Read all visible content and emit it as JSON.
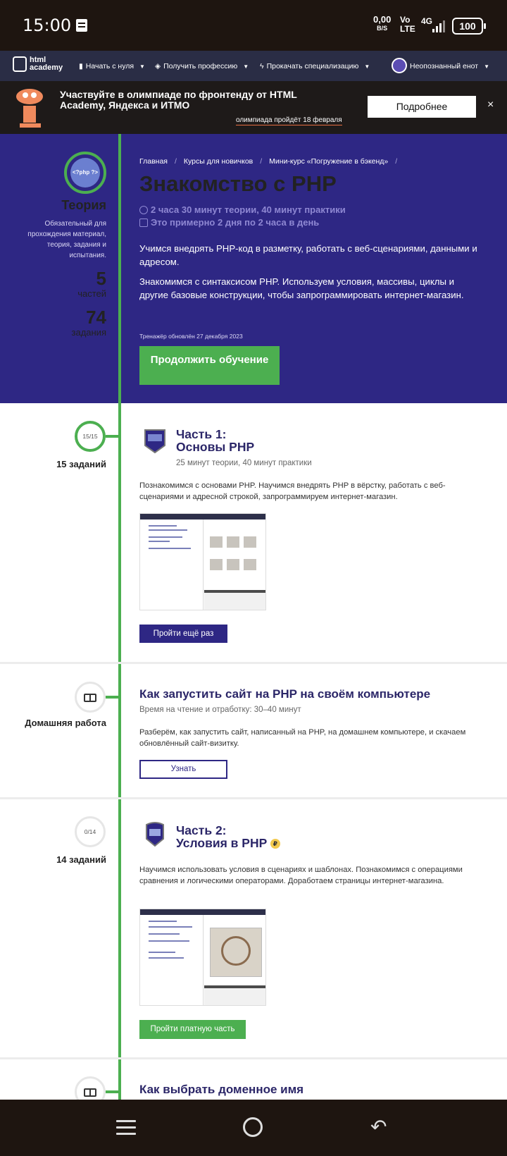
{
  "statusbar": {
    "time": "15:00",
    "speed": "0,00",
    "speed_unit": "B/S",
    "volte": "Vo",
    "lte": "LTE",
    "net": "4G",
    "battery": "100"
  },
  "nav": {
    "logo_line1": "html",
    "logo_line2": "academy",
    "items": [
      {
        "label": "Начать с нуля",
        "icon": "bars-icon"
      },
      {
        "label": "Получить профессию",
        "icon": "cap-icon"
      },
      {
        "label": "Прокачать специализацию",
        "icon": "bolt-icon"
      }
    ],
    "user": "Неопознанный енот"
  },
  "banner": {
    "title": "Участвуйте в олимпиаде по фронтенду от HTML Academy, Яндекса и ИТМО",
    "date": "олимпиада пройдёт 18 февраля",
    "button": "Подробнее",
    "close": "×"
  },
  "hero": {
    "badge": "<?php ?>",
    "side_title": "Теория",
    "side_desc": "Обязательный для прохождения материал, теория, задания и испытания.",
    "parts_count": "5",
    "parts_label": "частей",
    "tasks_count": "74",
    "tasks_label": "задания",
    "breadcrumbs": [
      "Главная",
      "Курсы для новичков",
      "Мини-курс «Погружение в бэкенд»"
    ],
    "sep": "/",
    "title": "Знакомство с PHP",
    "meta1": "2 часа 30 минут теории, 40 минут практики",
    "meta2": "Это примерно 2 дня по 2 часа в день",
    "p1": "Учимся внедрять PHP-код в разметку, работать с веб-сценариями, данными и адресом.",
    "p2": "Знакомимся с синтаксисом PHP. Используем условия, массивы, циклы и другие базовые конструкции, чтобы запрограммировать интернет-магазин.",
    "updated": "Тренажёр обновлён 27 декабря 2023",
    "continue": "Продолжить обучение"
  },
  "part1": {
    "progress": "15/15",
    "tasks": "15 заданий",
    "title_line1": "Часть 1:",
    "title_line2": "Основы PHP",
    "duration": "25 минут теории, 40 минут практики",
    "desc": "Познакомимся с основами PHP. Научимся внедрять PHP в вёрстку, работать с веб-сценариями и адресной строкой, запрограммируем интернет-магазин.",
    "button": "Пройти ещё раз"
  },
  "homework1": {
    "label": "Домашняя работа",
    "title": "Как запустить сайт на PHP на своём компьютере",
    "time": "Время на чтение и отработку: 30–40 минут",
    "desc": "Разберём, как запустить сайт, написанный на PHP, на домашнем компьютере, и скачаем обновлённый сайт-визитку.",
    "button": "Узнать"
  },
  "part2": {
    "progress": "0/14",
    "tasks": "14 заданий",
    "title_line1": "Часть 2:",
    "title_line2": "Условия в PHP",
    "paid_mark": "₽",
    "desc": "Научимся использовать условия в сценариях и шаблонах. Познакомимся с операциями сравнения и логическими операторами. Доработаем страницы интернет-магазина.",
    "button": "Пройти платную часть"
  },
  "homework2": {
    "title": "Как выбрать доменное имя"
  },
  "colors": {
    "hero_bg": "#2e2784",
    "accent_green": "#4caf50",
    "title_color": "#2b2668",
    "banner_bg": "#1e1a19"
  }
}
